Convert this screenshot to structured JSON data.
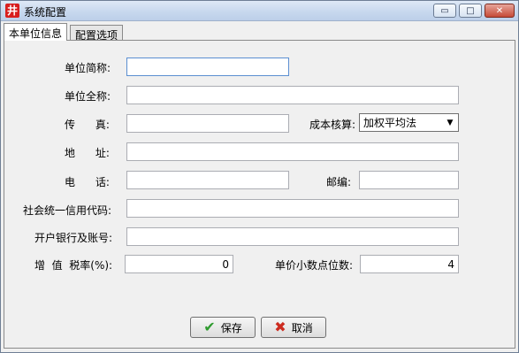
{
  "window": {
    "title": "系统配置",
    "app_icon_glyph": "井",
    "min_glyph": "▭",
    "max_glyph": "□",
    "close_glyph": "✕"
  },
  "tabs": [
    {
      "label": "本单位信息",
      "active": true
    },
    {
      "label": "配置选项",
      "active": false
    }
  ],
  "form": {
    "short_name": {
      "label": "单位简称:",
      "value": ""
    },
    "full_name": {
      "label": "单位全称:",
      "value": ""
    },
    "fax": {
      "label": "传      真:",
      "value": ""
    },
    "cost_method": {
      "label": "成本核算:",
      "value": "加权平均法",
      "arrow": "▼"
    },
    "address": {
      "label": "地      址:",
      "value": ""
    },
    "phone": {
      "label": "电      话:",
      "value": ""
    },
    "postcode": {
      "label": "邮编:",
      "value": ""
    },
    "credit_code": {
      "label": "社会统一信用代码:",
      "value": ""
    },
    "bank_account": {
      "label": "开户银行及账号:",
      "value": ""
    },
    "vat_rate": {
      "label": "增  值  税率(%):",
      "value": "0"
    },
    "price_decimals": {
      "label": "单价小数点位数:",
      "value": "4"
    }
  },
  "buttons": {
    "save": {
      "label": "保存",
      "icon": "✔"
    },
    "cancel": {
      "label": "取消",
      "icon": "✖"
    }
  },
  "colors": {
    "titlebar": "#c8d8ee",
    "close_button": "#c64a37",
    "app_icon": "#d81e1e",
    "save_icon": "#2f9b2f",
    "cancel_icon": "#cc2b1f"
  }
}
